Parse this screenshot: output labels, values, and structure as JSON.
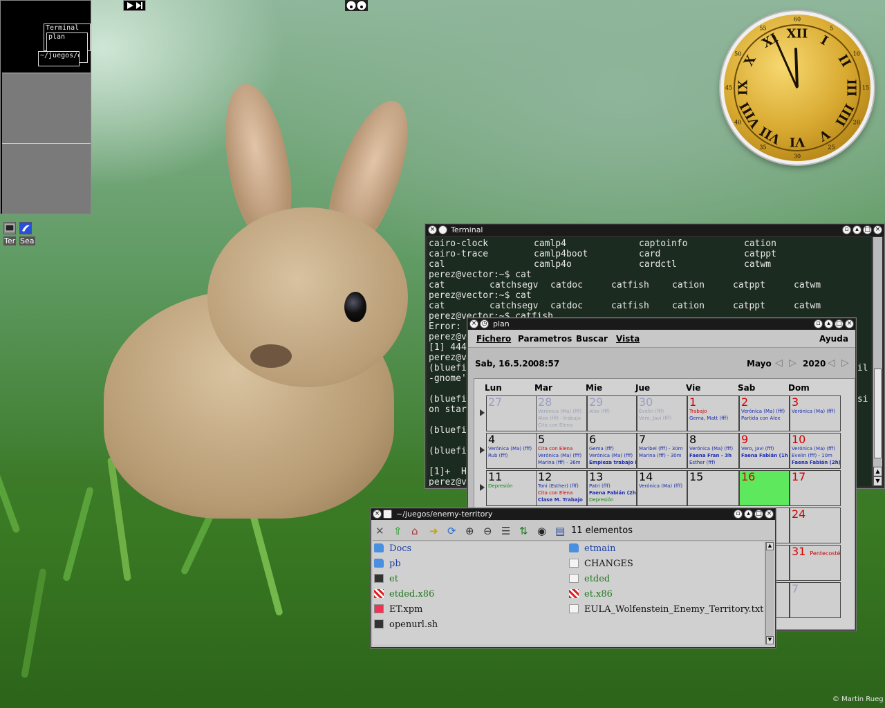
{
  "pager": {
    "windows": [
      "Terminal",
      "plan",
      "~/juegos/e"
    ]
  },
  "topbar": {
    "media_icons": [
      "play-next-icon",
      "xeyes-icon"
    ]
  },
  "taskbar": {
    "items": [
      {
        "icon": "terminal-icon",
        "label": "Ter"
      },
      {
        "icon": "seamonkey-icon",
        "label": "Sea"
      }
    ]
  },
  "terminal": {
    "title": "Terminal",
    "lines": [
      [
        "cairo-clock",
        "camlp4",
        "captoinfo",
        "cation"
      ],
      [
        "cairo-trace",
        "camlp4boot",
        "card",
        "catppt"
      ],
      [
        "cal",
        "camlp4o",
        "cardctl",
        "catwm"
      ],
      [
        "perez@vector:~$ cat"
      ],
      [
        "cat",
        "catchsegv",
        "catdoc",
        "catfish",
        "cation",
        "catppt",
        "catwm"
      ],
      [
        "perez@vector:~$ cat"
      ],
      [
        "cat",
        "catchsegv",
        "catdoc",
        "catfish",
        "cation",
        "catppt",
        "catwm"
      ],
      [
        "perez@vector:~$ catfish"
      ],
      [
        "Error:"
      ],
      [
        "perez@v"
      ],
      [
        "[1] 444"
      ],
      [
        "perez@v"
      ],
      [
        "(bluefi",
        "ail"
      ],
      [
        "-gnome'"
      ],
      [
        ""
      ],
      [
        "(bluefi",
        "ssi"
      ],
      [
        "on star"
      ],
      [
        ""
      ],
      [
        "(bluefi"
      ],
      [
        ""
      ],
      [
        "(bluefi"
      ],
      [
        ""
      ],
      [
        "[1]+  H"
      ],
      [
        "perez@v"
      ]
    ]
  },
  "plan": {
    "title": "plan",
    "menu": [
      "Fichero",
      "Parametros",
      "Buscar",
      "Vista",
      "Ayuda"
    ],
    "today": "Sab, 16.5.20",
    "time": "08:57",
    "month": "Mayo",
    "year": "2020",
    "weekdays": [
      "Lun",
      "Mar",
      "Mie",
      "Jue",
      "Vie",
      "Sab",
      "Dom"
    ],
    "weeks": [
      [
        {
          "d": "27",
          "s": "o",
          "ev": []
        },
        {
          "d": "28",
          "s": "o",
          "ev": [
            {
              "t": "Verónica (Ma) (fff)",
              "c": "gr"
            },
            {
              "t": "Alex (fff) - trabajo",
              "c": "gr"
            },
            {
              "t": "Cita con Elena",
              "c": "gr"
            }
          ]
        },
        {
          "d": "29",
          "s": "o",
          "ev": [
            {
              "t": "Alex (fff)",
              "c": "gr"
            }
          ]
        },
        {
          "d": "30",
          "s": "o",
          "ev": [
            {
              "t": "Evelin (fff)",
              "c": "gr"
            },
            {
              "t": "Vero, Javi (fff)",
              "c": "gr"
            }
          ]
        },
        {
          "d": "1",
          "s": "r",
          "ev": [
            {
              "t": "Trabajo",
              "c": "rr"
            },
            {
              "t": "Gema, Matt (fff)",
              "c": ""
            }
          ]
        },
        {
          "d": "2",
          "s": "r",
          "ev": [
            {
              "t": "Verónica (Ma) (fff)",
              "c": ""
            },
            {
              "t": "Partida con Alex",
              "c": ""
            }
          ]
        },
        {
          "d": "3",
          "s": "r",
          "ev": [
            {
              "t": "Verónica (Ma) (fff)",
              "c": ""
            }
          ]
        }
      ],
      [
        {
          "d": "4",
          "s": "",
          "ev": [
            {
              "t": "Verónica (Ma) (fff)",
              "c": ""
            },
            {
              "t": "Rub (fff)",
              "c": ""
            }
          ]
        },
        {
          "d": "5",
          "s": "",
          "ev": [
            {
              "t": "Cita con Elena",
              "c": "rr"
            },
            {
              "t": "Verónica (Ma) (fff)",
              "c": ""
            },
            {
              "t": "Marina (fff) - 36m",
              "c": ""
            }
          ]
        },
        {
          "d": "6",
          "s": "",
          "ev": [
            {
              "t": "Gema (fff)",
              "c": ""
            },
            {
              "t": "Verónica (Ma) (fff)",
              "c": ""
            },
            {
              "t": "Empieza trabajo M",
              "c": "b"
            }
          ]
        },
        {
          "d": "7",
          "s": "",
          "ev": [
            {
              "t": "Maribel (fff) - 30m",
              "c": ""
            },
            {
              "t": "Marina (fff) - 30m",
              "c": ""
            }
          ]
        },
        {
          "d": "8",
          "s": "",
          "ev": [
            {
              "t": "Verónica (Ma) (fff)",
              "c": ""
            },
            {
              "t": "Faena Fran - 3h",
              "c": "b"
            },
            {
              "t": "Esther (fff)",
              "c": ""
            }
          ]
        },
        {
          "d": "9",
          "s": "r",
          "ev": [
            {
              "t": "Vero, Javi (fff)",
              "c": ""
            },
            {
              "t": "Faena Fabián (1h",
              "c": "b"
            }
          ]
        },
        {
          "d": "10",
          "s": "r",
          "ev": [
            {
              "t": "Verónica (Ma) (fff)",
              "c": ""
            },
            {
              "t": "Evelin (fff) - 10m",
              "c": ""
            },
            {
              "t": "Faena Fabián (2h)",
              "c": "b"
            }
          ]
        }
      ],
      [
        {
          "d": "11",
          "s": "",
          "ev": [
            {
              "t": "Depresión",
              "c": "g"
            }
          ]
        },
        {
          "d": "12",
          "s": "",
          "ev": [
            {
              "t": "Toni (Esther) (fff)",
              "c": ""
            },
            {
              "t": "Cita con Elena",
              "c": "rr"
            },
            {
              "t": "Clase M. Trabajo",
              "c": "b"
            }
          ]
        },
        {
          "d": "13",
          "s": "",
          "ev": [
            {
              "t": "Patri (fff)",
              "c": ""
            },
            {
              "t": "Faena Fabián (2h)",
              "c": "b"
            },
            {
              "t": "Depresión",
              "c": "g"
            }
          ]
        },
        {
          "d": "14",
          "s": "",
          "ev": [
            {
              "t": "Verónica (Ma) (fff)",
              "c": ""
            }
          ]
        },
        {
          "d": "15",
          "s": "",
          "ev": []
        },
        {
          "d": "16",
          "s": "r",
          "today": true,
          "ev": []
        },
        {
          "d": "17",
          "s": "r",
          "ev": []
        }
      ],
      [
        {
          "d": "",
          "s": "",
          "ev": []
        },
        {
          "d": "",
          "s": "",
          "ev": []
        },
        {
          "d": "",
          "s": "",
          "ev": []
        },
        {
          "d": "",
          "s": "",
          "ev": []
        },
        {
          "d": "",
          "s": "",
          "ev": []
        },
        {
          "d": "",
          "s": "",
          "ev": []
        },
        {
          "d": "24",
          "s": "r",
          "ev": []
        }
      ],
      [
        {
          "d": "",
          "s": "",
          "ev": []
        },
        {
          "d": "",
          "s": "",
          "ev": []
        },
        {
          "d": "",
          "s": "",
          "ev": []
        },
        {
          "d": "",
          "s": "",
          "ev": []
        },
        {
          "d": "",
          "s": "",
          "ev": []
        },
        {
          "d": "",
          "s": "",
          "ev": []
        },
        {
          "d": "31",
          "s": "r",
          "note": "Pentecostés",
          "ev": []
        }
      ],
      [
        {
          "d": "",
          "s": "",
          "ev": []
        },
        {
          "d": "",
          "s": "",
          "ev": []
        },
        {
          "d": "",
          "s": "",
          "ev": []
        },
        {
          "d": "",
          "s": "",
          "ev": []
        },
        {
          "d": "",
          "s": "",
          "ev": []
        },
        {
          "d": "",
          "s": "",
          "ev": []
        },
        {
          "d": "7",
          "s": "o",
          "ev": []
        }
      ]
    ]
  },
  "filemanager": {
    "title": "~/juegos/enemy-territory",
    "count": "11 elementos",
    "toolbar_icons": [
      "close-icon",
      "up-icon",
      "home-icon",
      "forward-icon",
      "reload-icon",
      "zoom-in-icon",
      "zoom-out-icon",
      "list-view-icon",
      "sort-icon",
      "eye-icon",
      "details-icon"
    ],
    "items": [
      {
        "name": "Docs",
        "type": "folder",
        "color": "#1b3fa6"
      },
      {
        "name": "etmain",
        "type": "folder",
        "color": "#1b3fa6"
      },
      {
        "name": "pb",
        "type": "folder",
        "color": "#1b3fa6"
      },
      {
        "name": "CHANGES",
        "type": "text",
        "color": "#111111"
      },
      {
        "name": "et",
        "type": "exec",
        "color": "#1f7a1f"
      },
      {
        "name": "etded",
        "type": "text",
        "color": "#1f7a1f"
      },
      {
        "name": "etded.x86",
        "type": "binary",
        "color": "#1f7a1f"
      },
      {
        "name": "et.x86",
        "type": "binary",
        "color": "#1f7a1f"
      },
      {
        "name": "ET.xpm",
        "type": "image",
        "color": "#111111"
      },
      {
        "name": "EULA_Wolfenstein_Enemy_Territory.txt",
        "type": "text",
        "color": "#111111"
      },
      {
        "name": "openurl.sh",
        "type": "exec",
        "color": "#111111"
      }
    ]
  },
  "clock": {
    "hour": 11,
    "minute": 56,
    "numerals": [
      "XII",
      "I",
      "II",
      "III",
      "IIII",
      "V",
      "VI",
      "VII",
      "VIII",
      "IX",
      "X",
      "XI"
    ],
    "minute_labels": [
      "60",
      "5",
      "10",
      "15",
      "20",
      "25",
      "30",
      "35",
      "40",
      "45",
      "50",
      "55"
    ]
  },
  "credit": "© Martin Rueg",
  "colors": {
    "today_cell": "#5de85d",
    "holiday": "#d40000",
    "event_blue": "#1b2bb0",
    "event_green": "#0a8f0a"
  }
}
